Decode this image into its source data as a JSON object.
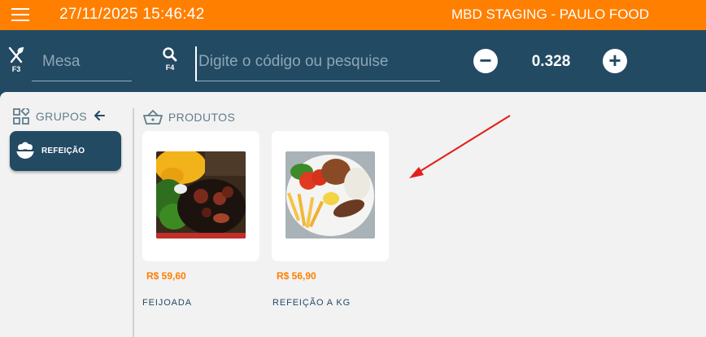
{
  "header": {
    "datetime": "27/11/2025 15:46:42",
    "app_title": "MBD STAGING - PAULO FOOD"
  },
  "toolbar": {
    "mesa_key": "F3",
    "mesa_placeholder": "Mesa",
    "search_key": "F4",
    "search_placeholder": "Digite o código ou pesquise",
    "quantity": "0.328",
    "minus_label": "−",
    "plus_label": "+"
  },
  "sidebar": {
    "header": "GRUPOS",
    "items": [
      {
        "label": "REFEIÇÃO"
      }
    ]
  },
  "products": {
    "header": "PRODUTOS",
    "items": [
      {
        "name": "FEIJOADA",
        "price": "R$ 59,60"
      },
      {
        "name": "REFEIÇÃO A KG",
        "price": "R$ 56,90"
      }
    ]
  },
  "colors": {
    "header_orange": "#ff7f00",
    "navy": "#224a63",
    "price_orange": "#ff7f00",
    "annotation_red": "#e3201b"
  },
  "icons": [
    "menu-icon",
    "utensils-icon",
    "search-icon",
    "grid-icon",
    "back-arrow-icon",
    "rice-bowl-icon",
    "basket-icon"
  ]
}
